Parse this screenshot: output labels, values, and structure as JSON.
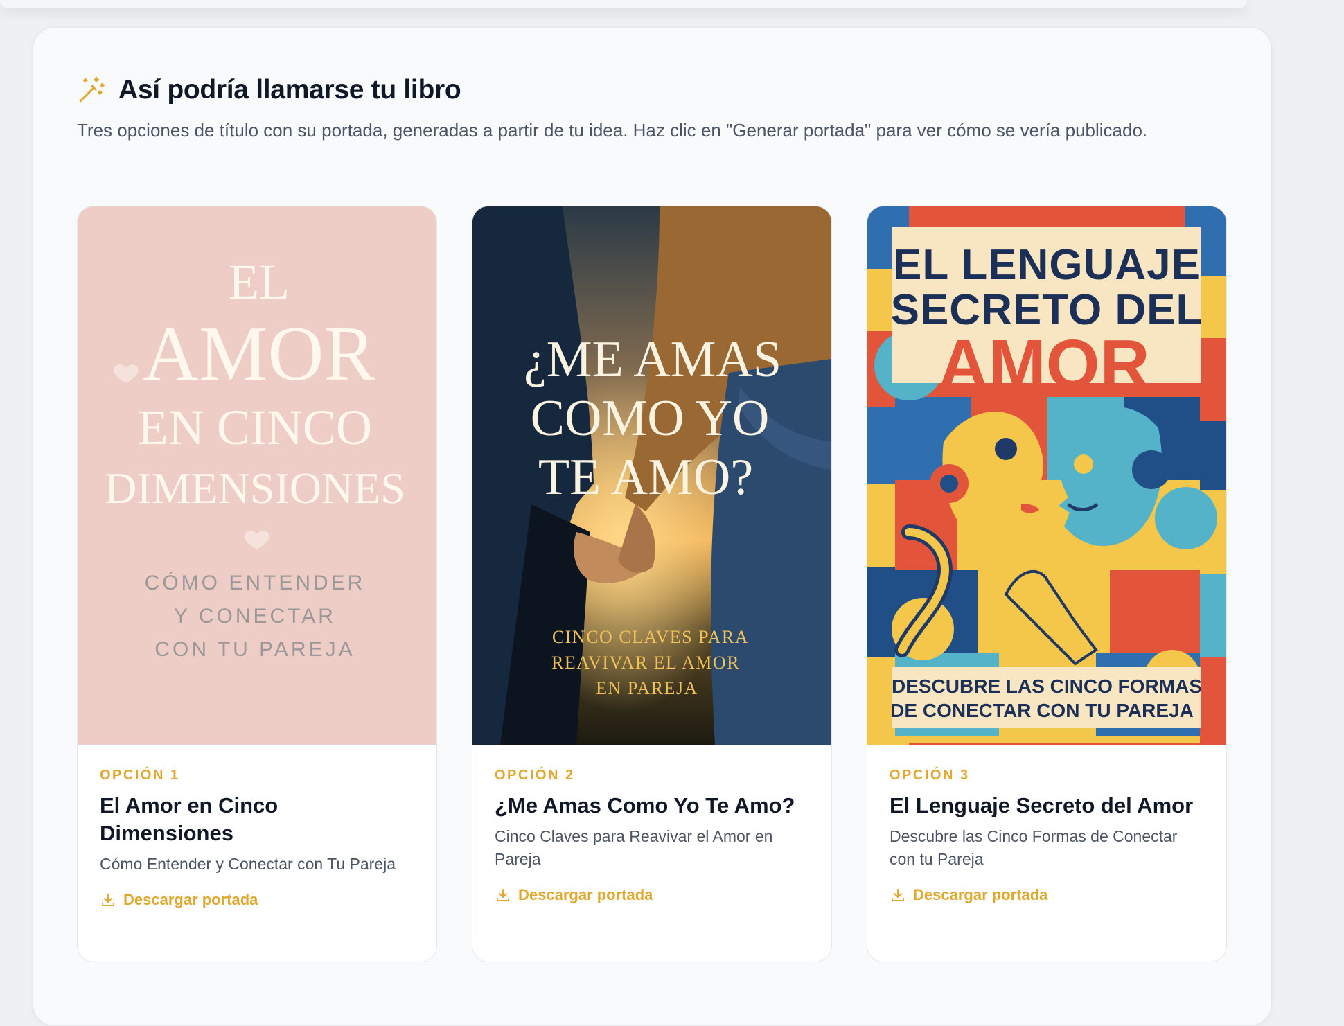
{
  "section": {
    "icon": "magic-wand-icon",
    "title": "Así podría llamarse tu libro",
    "subtitle": "Tres opciones de título con su portada, generadas a partir de tu idea. Haz clic en \"Generar portada\" para ver cómo se vería publicado."
  },
  "colors": {
    "accent": "#e0a82e",
    "title": "#101828",
    "muted": "#4b5563"
  },
  "cards": [
    {
      "option": "OPCIÓN 1",
      "title": "El Amor en Cinco Dimensiones",
      "subtitle": "Cómo Entender y Conectar con Tu Pareja",
      "download": "Descargar portada",
      "cover": {
        "line1": "EL",
        "line2": "AMOR",
        "line3": "EN CINCO",
        "line4": "DIMENSIONES",
        "tag1": "CÓMO ENTENDER",
        "tag2": "Y CONECTAR",
        "tag3": "CON TU PAREJA"
      }
    },
    {
      "option": "OPCIÓN 2",
      "title": "¿Me Amas Como Yo Te Amo?",
      "subtitle": "Cinco Claves para Reavivar el Amor en Pareja",
      "download": "Descargar portada",
      "cover": {
        "line1": "¿ME AMAS",
        "line2": "COMO YO",
        "line3": "TE AMO?",
        "tag1": "CINCO CLAVES PARA",
        "tag2": "REAVIVAR EL AMOR",
        "tag3": "EN PAREJA"
      }
    },
    {
      "option": "OPCIÓN 3",
      "title": "El Lenguaje Secreto del Amor",
      "subtitle": "Descubre las Cinco Formas de Conectar con tu Pareja",
      "download": "Descargar portada",
      "cover": {
        "line1": "EL LENGUAJE",
        "line2": "SECRETO DEL",
        "line3": "AMOR",
        "tag1": "DESCUBRE LAS CINCO FORMAS",
        "tag2": "DE CONECTAR CON TU PAREJA"
      }
    }
  ]
}
